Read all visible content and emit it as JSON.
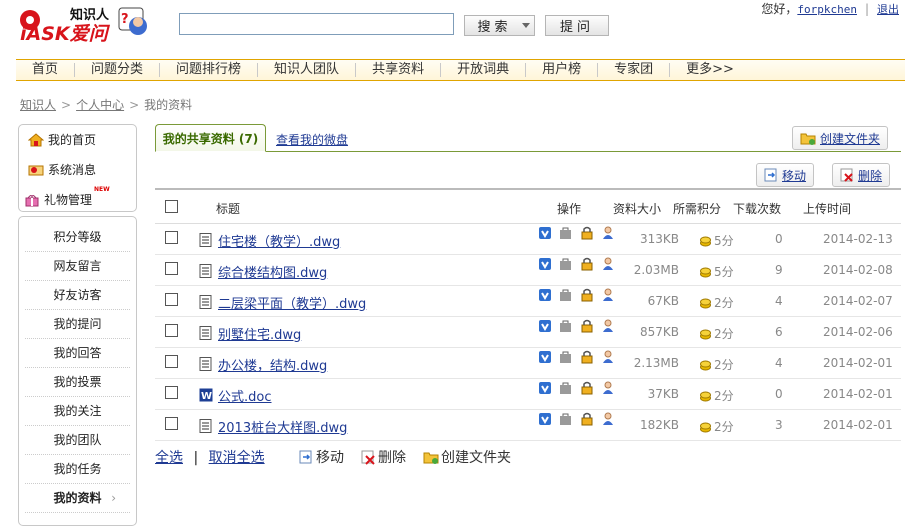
{
  "header": {
    "logo_text_top": "知识人",
    "logo_text_main": "iASK爱问",
    "search_value": "",
    "search_button": "搜索",
    "ask_button": "提问",
    "greeting": "您好，",
    "username": "forpkchen",
    "logout": "退出"
  },
  "nav": [
    "首页",
    "问题分类",
    "问题排行榜",
    "知识人团队",
    "共享资料",
    "开放词典",
    "用户榜",
    "专家团",
    "更多>>"
  ],
  "breadcrumb": [
    "知识人",
    "个人中心",
    "我的资料"
  ],
  "sidebar": {
    "top": [
      {
        "label": "我的首页",
        "icon": "home-icon"
      },
      {
        "label": "系统消息",
        "icon": "message-icon"
      },
      {
        "label": "礼物管理",
        "icon": "gift-icon"
      }
    ],
    "new_badge": "NEW",
    "items": [
      "积分等级",
      "网友留言",
      "好友访客",
      "我的提问",
      "我的回答",
      "我的投票",
      "我的关注",
      "我的团队",
      "我的任务",
      "我的资料"
    ]
  },
  "tabs": {
    "shared": "我的共享资料 (7)",
    "disk": "查看我的微盘"
  },
  "actions": {
    "create_folder": "创建文件夹",
    "move": "移动",
    "delete": "删除"
  },
  "table": {
    "headers": {
      "title": "标题",
      "ops": "操作",
      "size": "资料大小",
      "points": "所需积分",
      "downloads": "下载次数",
      "upload_time": "上传时间"
    },
    "rows": [
      {
        "name": "住宅楼（教学）.dwg",
        "type": "dwg",
        "size": "313KB",
        "points": "5分",
        "downloads": "0",
        "date": "2014-02-13"
      },
      {
        "name": "综合楼结构图.dwg",
        "type": "dwg",
        "size": "2.03MB",
        "points": "5分",
        "downloads": "9",
        "date": "2014-02-08"
      },
      {
        "name": "二层梁平面（教学）.dwg",
        "type": "dwg",
        "size": "67KB",
        "points": "2分",
        "downloads": "4",
        "date": "2014-02-07"
      },
      {
        "name": "别墅住宅.dwg",
        "type": "dwg",
        "size": "857KB",
        "points": "2分",
        "downloads": "6",
        "date": "2014-02-06"
      },
      {
        "name": "办公楼，结构.dwg",
        "type": "dwg",
        "size": "2.13MB",
        "points": "2分",
        "downloads": "4",
        "date": "2014-02-01"
      },
      {
        "name": "公式.doc",
        "type": "doc",
        "size": "37KB",
        "points": "2分",
        "downloads": "0",
        "date": "2014-02-01"
      },
      {
        "name": "2013桩台大样图.dwg",
        "type": "dwg",
        "size": "182KB",
        "points": "2分",
        "downloads": "3",
        "date": "2014-02-01"
      }
    ]
  },
  "footer": {
    "select_all": "全选",
    "separator": "|",
    "deselect_all": "取消全选",
    "move": "移动",
    "delete": "删除",
    "create_folder": "创建文件夹"
  },
  "colors": {
    "link": "#1f3a93",
    "nav_border": "#e0a400",
    "tab_green": "#3a6a00",
    "coin": "#e8b800"
  }
}
